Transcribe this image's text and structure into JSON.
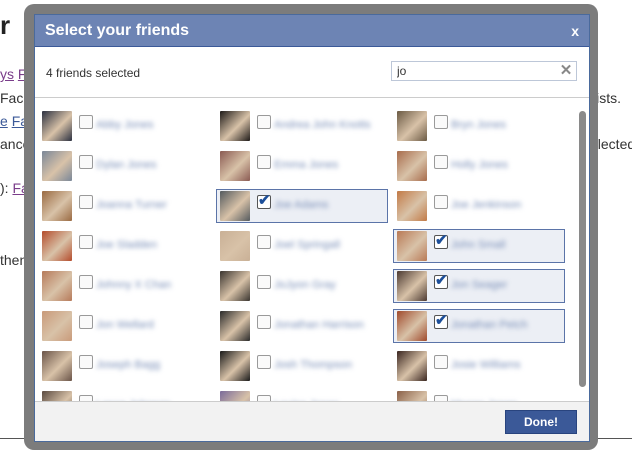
{
  "background": {
    "heading_fragment": "r",
    "line1_link1": "ys",
    "line1_link2": "Fa",
    "line2": "Faceb",
    "line3_link": "e",
    "line3_link2": "Fac",
    "line4": "ances",
    "line5_prefix": "):",
    "line5_link": "Fa",
    "line6": "then",
    "right1": "lists.",
    "right2": "elected"
  },
  "dialog": {
    "title": "Select your friends",
    "close_label": "x",
    "selected_count": "4 friends selected",
    "search_value": "jo",
    "done_label": "Done!"
  },
  "friends": [
    {
      "name": "Abby Jones",
      "checked": false,
      "photo": "#2b3040"
    },
    {
      "name": "Andrea John Knotts",
      "checked": false,
      "photo": "#1e1a18"
    },
    {
      "name": "Bryn Jones",
      "checked": false,
      "photo": "#6b5a44"
    },
    {
      "name": "Dylan Jones",
      "checked": false,
      "photo": "#7a8798"
    },
    {
      "name": "Emma Jones",
      "checked": false,
      "photo": "#8a5a52"
    },
    {
      "name": "Holly Jones",
      "checked": false,
      "photo": "#a86c4c"
    },
    {
      "name": "Joanna Turner",
      "checked": false,
      "photo": "#9a6a42"
    },
    {
      "name": "Joe Adams",
      "checked": true,
      "photo": "#545a5e"
    },
    {
      "name": "Joe Jenkinson",
      "checked": false,
      "photo": "#c27a46"
    },
    {
      "name": "Joe Sladden",
      "checked": false,
      "photo": "#b44c2c"
    },
    {
      "name": "Joel Springall",
      "checked": false,
      "photo": "#c9b096"
    },
    {
      "name": "John Small",
      "checked": true,
      "photo": "#b97a56"
    },
    {
      "name": "Johnny X Chan",
      "checked": false,
      "photo": "#b67a5a"
    },
    {
      "name": "JoJyon Gray",
      "checked": false,
      "photo": "#3a3530"
    },
    {
      "name": "Jon Seager",
      "checked": true,
      "photo": "#4c3a32"
    },
    {
      "name": "Jon Wellard",
      "checked": false,
      "photo": "#c99a7a"
    },
    {
      "name": "Jonathan Harrison",
      "checked": false,
      "photo": "#2a2a2a"
    },
    {
      "name": "Jonathan Petch",
      "checked": true,
      "photo": "#a04a2c"
    },
    {
      "name": "Joseph Bagg",
      "checked": false,
      "photo": "#6a5448"
    },
    {
      "name": "Josh Thompson",
      "checked": false,
      "photo": "#1a1a1a"
    },
    {
      "name": "Josie Williams",
      "checked": false,
      "photo": "#3a2620"
    },
    {
      "name": "Lance Johnson",
      "checked": false,
      "photo": "#5a4a40"
    },
    {
      "name": "Louisa Jones",
      "checked": false,
      "photo": "#7a6a9a"
    },
    {
      "name": "Megan Jones",
      "checked": false,
      "photo": "#8a6048"
    }
  ]
}
